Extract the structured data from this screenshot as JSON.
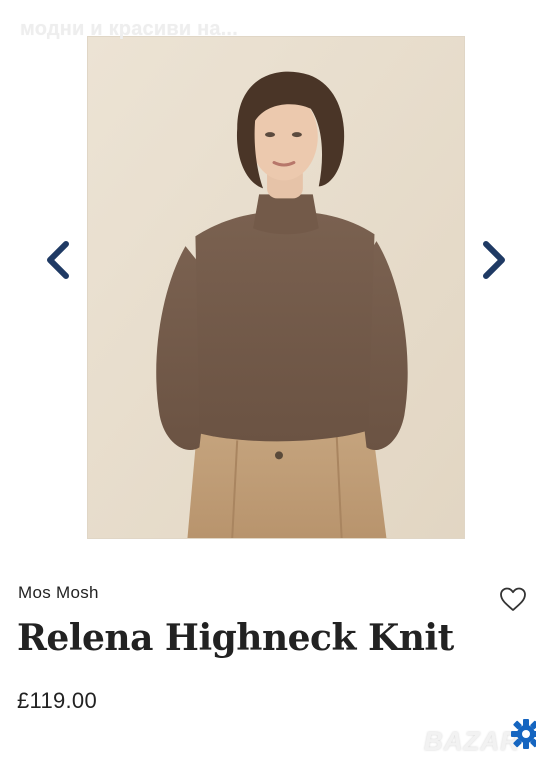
{
  "header": {
    "caption": "модни и красиви на..."
  },
  "gallery": {
    "prev_icon": "chevron-left-icon",
    "next_icon": "chevron-right-icon",
    "arrow_color": "#1f3a64"
  },
  "product": {
    "brand": "Mos Mosh",
    "title": "Relena Highneck Knit",
    "price": "£119.00",
    "favorite_icon": "heart-outline-icon"
  },
  "watermark": {
    "text": "BAZAR",
    "gear_color": "#1565c0"
  }
}
